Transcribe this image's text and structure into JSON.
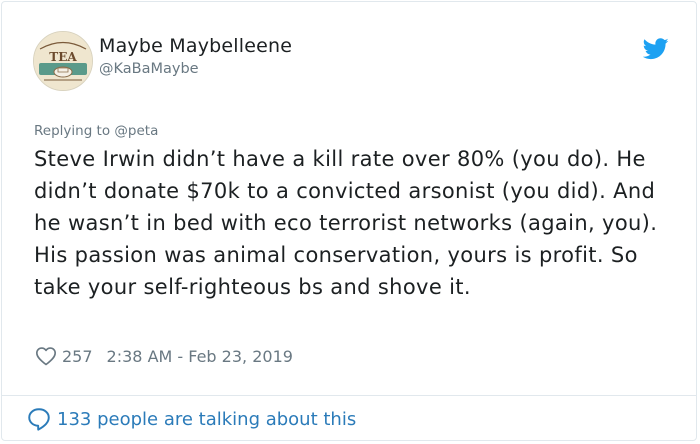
{
  "author": {
    "name": "Maybe Maybelleene",
    "handle": "@KaBaMaybe",
    "avatar_text": "TEA"
  },
  "tweet": {
    "replying_to": "Replying to @peta",
    "text": "Steve Irwin didn’t have a kill rate over 80% (you do). He didn’t donate $70k to a convicted arsonist (you did). And he wasn’t in bed with eco terrorist networks (again, you). His passion was animal conservation, yours is profit. So take your self-righteous bs and shove it.",
    "likes": "257",
    "timestamp": "2:38 AM - Feb 23, 2019"
  },
  "footer": {
    "conversation": "133 people are talking about this"
  },
  "icons": {
    "bird": "twitter-bird-icon",
    "heart": "heart-icon",
    "bubble": "speech-bubble-icon"
  },
  "colors": {
    "twitter_blue": "#1da1f2",
    "link_blue": "#2b7bb9",
    "muted": "#697882",
    "text": "#1c2022"
  }
}
